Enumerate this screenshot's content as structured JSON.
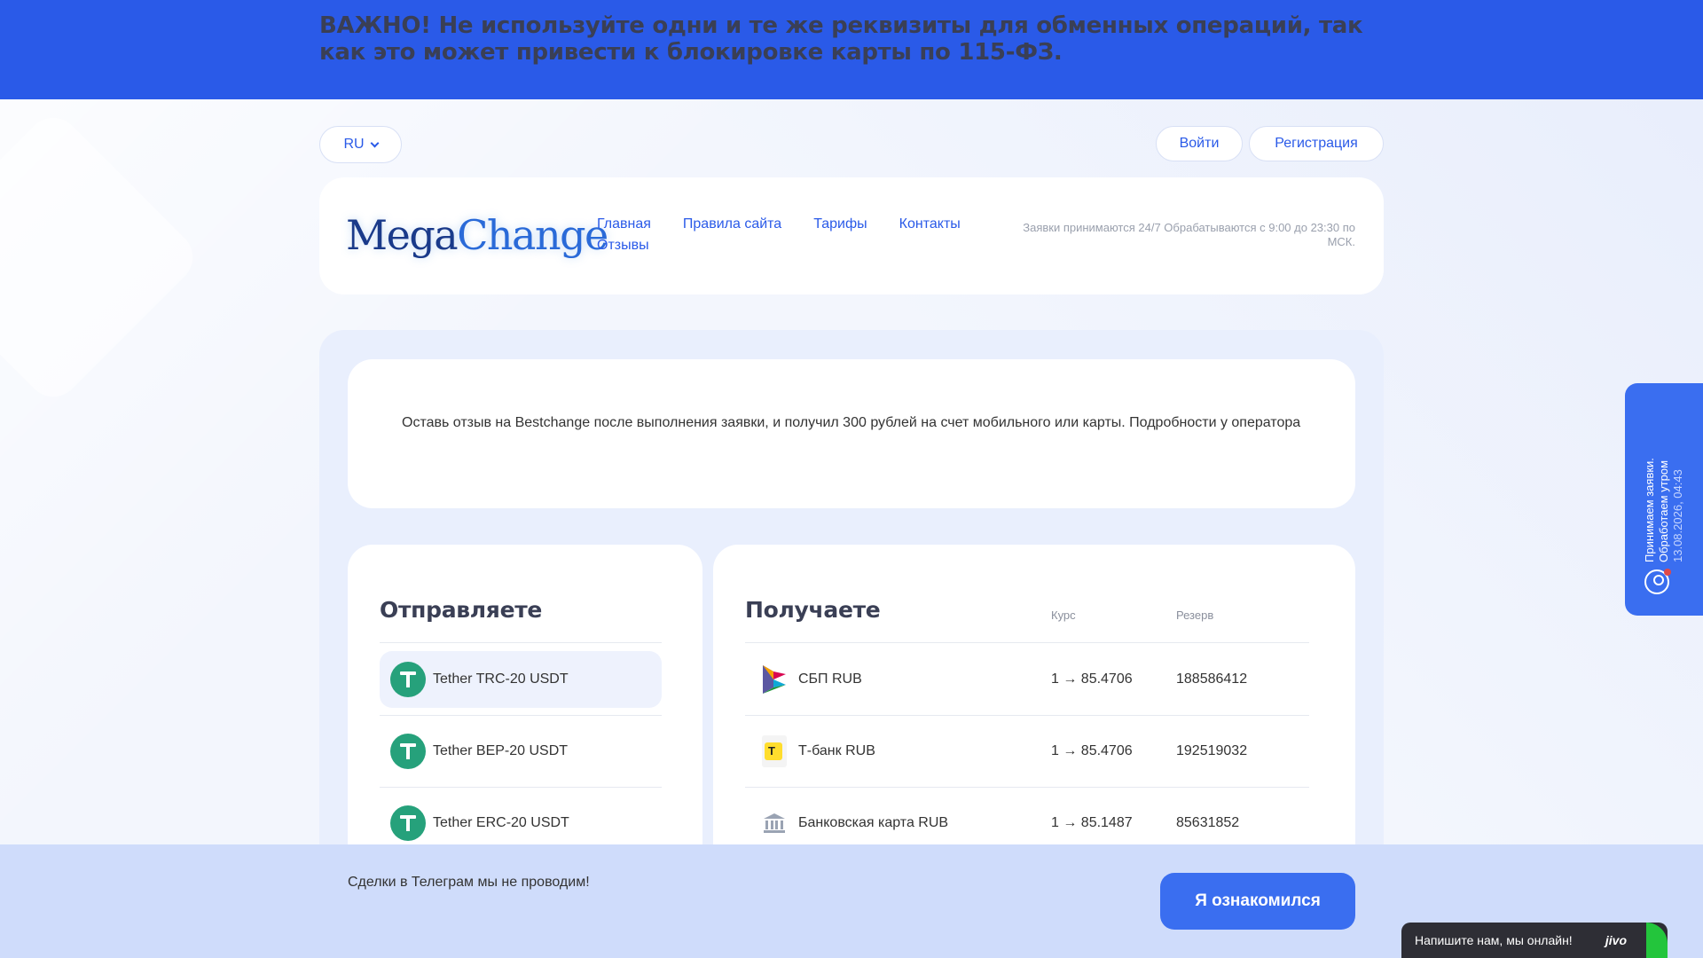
{
  "banner": {
    "text": "ВАЖНО! Не используйте одни и те же реквизиты для обменных операций, так как это может привести к блокировке карты по 115-ФЗ."
  },
  "header": {
    "lang": "RU",
    "login_label": "Войти",
    "register_label": "Регистрация",
    "logo_part1": "Mega",
    "logo_part2": "Change",
    "nav": [
      "Главная",
      "Правила сайта",
      "Тарифы",
      "Контакты",
      "Отзывы"
    ],
    "hours": "Заявки принимаются 24/7 Обрабатываются с 9:00 до 23:30 по МСК."
  },
  "notice": {
    "text": "Оставь отзыв на Bestchange после выполнения заявки, и получил 300 рублей на счет мобильного или карты. Подробности у оператора"
  },
  "send": {
    "title": "Отправляете",
    "items": [
      {
        "label": "Tether TRC-20 USDT",
        "icon": "tether-icon"
      },
      {
        "label": "Tether BEP-20 USDT",
        "icon": "tether-icon"
      },
      {
        "label": "Tether ERC-20 USDT",
        "icon": "tether-icon"
      }
    ]
  },
  "receive": {
    "title": "Получаете",
    "col_rate": "Курс",
    "col_reserve": "Резерв",
    "rows": [
      {
        "name": "СБП RUB",
        "rate": "1 → 85.4706",
        "reserve": "188586412",
        "icon": "sbp-icon"
      },
      {
        "name": "Т-банк RUB",
        "rate": "1 → 85.4706",
        "reserve": "192519032",
        "icon": "tbank-icon"
      },
      {
        "name": "Банковская карта RUB",
        "rate": "1 → 85.1487",
        "reserve": "85631852",
        "icon": "bank-icon"
      }
    ]
  },
  "cookie": {
    "text": "Сделки в Телеграм мы не проводим!",
    "button": "Я ознакомился"
  },
  "side_widget": {
    "line1": "Принимаем заявки.",
    "line2": "Обработаем утром",
    "timestamp": "13.08.2026, 04:43"
  },
  "chat": {
    "text": "Напишите нам, мы онлайн!",
    "brand": "jivo"
  },
  "colors": {
    "accent": "#2a5ae8",
    "button": "#3a6ef0",
    "tether": "#26a17b"
  }
}
